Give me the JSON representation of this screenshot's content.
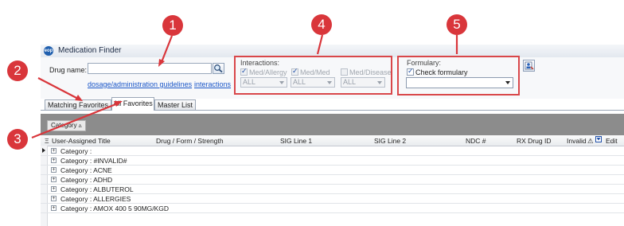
{
  "window": {
    "title": "Medication Finder",
    "app_icon": "eop"
  },
  "finder": {
    "drug_name_label": "Drug name:",
    "drug_name_value": "",
    "dosage_link": "dosage/administration guidelines",
    "interactions_link": "interactions"
  },
  "interactions": {
    "label": "Interactions:",
    "checks": [
      {
        "label": "Med/Allergy",
        "checked": true,
        "enabled": false
      },
      {
        "label": "Med/Med",
        "checked": true,
        "enabled": false
      },
      {
        "label": "Med/Disease",
        "checked": false,
        "enabled": false
      }
    ],
    "selects": [
      "ALL",
      "ALL",
      "ALL"
    ]
  },
  "formulary": {
    "label": "Formulary:",
    "check_label": "Check formulary",
    "checked": true,
    "select_value": ""
  },
  "tabs": [
    "Matching Favorites",
    "All Favorites",
    "Master List"
  ],
  "active_tab": "All Favorites",
  "group_by_chip": "Category ▵",
  "columns": [
    "User-Assigned Title",
    "Drug / Form / Strength",
    "SIG Line 1",
    "SIG Line 2",
    "NDC #",
    "RX Drug ID",
    "Invalid",
    "Edit"
  ],
  "rows": [
    "Category :",
    "Category : #INVALID#",
    "Category : ACNE",
    "Category : ADHD",
    "Category : ALBUTEROL",
    "Category : ALLERGIES",
    "Category : AMOX 400 5 90MG/KGD"
  ],
  "callouts": [
    "1",
    "2",
    "3",
    "4",
    "5"
  ],
  "colors": {
    "callout": "#d9363b",
    "link": "#1a56c8",
    "groupbar": "#8c8c8c"
  }
}
